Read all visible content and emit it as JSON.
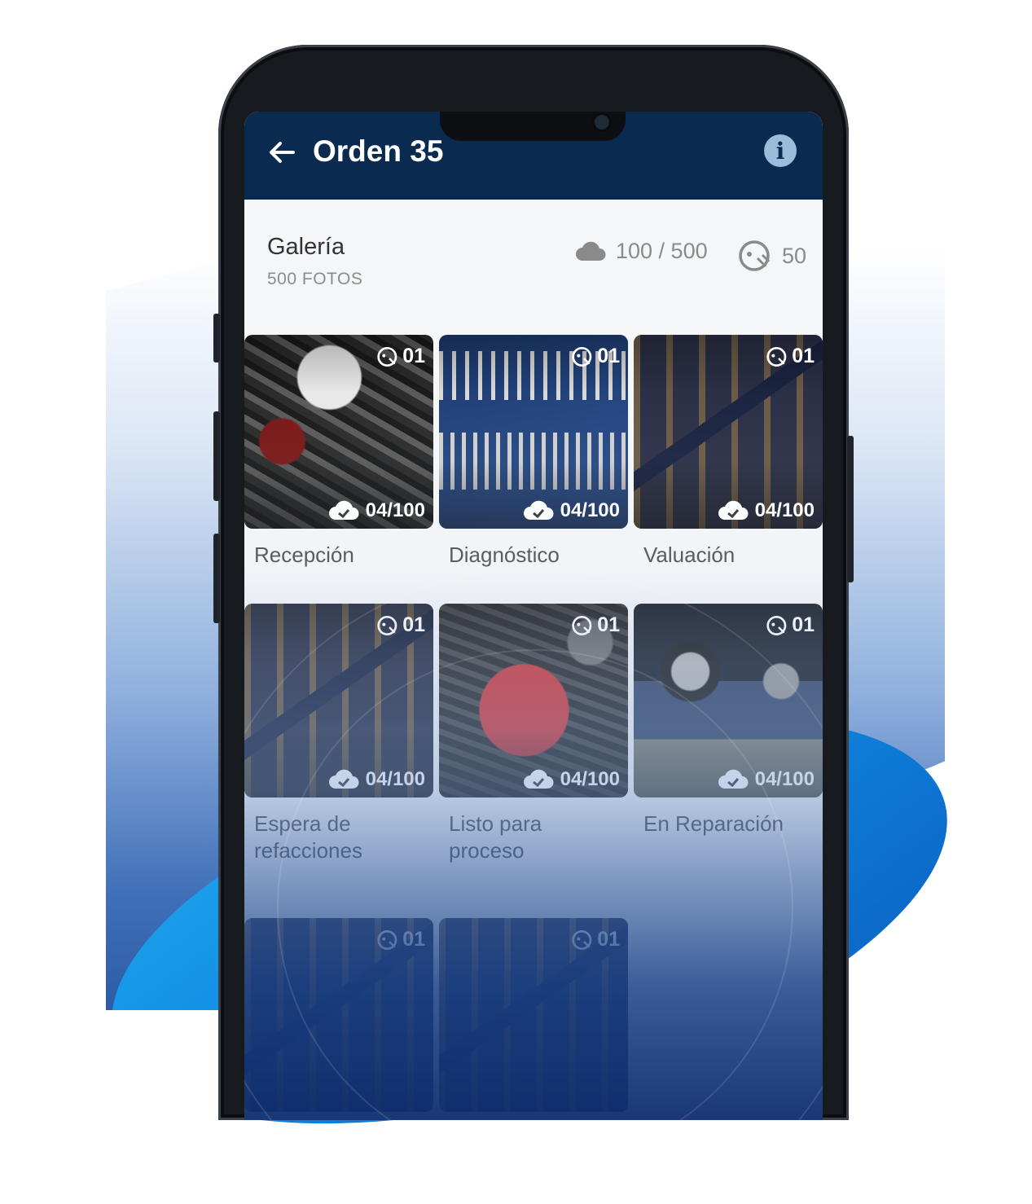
{
  "appbar": {
    "title": "Orden 35"
  },
  "gallery": {
    "title": "Galería",
    "subtitle": "500 FOTOS",
    "cloud_stat": "100 / 500",
    "ai_stat": "50"
  },
  "items": [
    {
      "label": "Recepción",
      "count": "01",
      "uploaded": "04/100"
    },
    {
      "label": "Diagnóstico",
      "count": "01",
      "uploaded": "04/100"
    },
    {
      "label": "Valuación",
      "count": "01",
      "uploaded": "04/100"
    },
    {
      "label": "Espera de refacciones",
      "count": "01",
      "uploaded": "04/100"
    },
    {
      "label": "Listo para proceso",
      "count": "01",
      "uploaded": "04/100"
    },
    {
      "label": "En Reparación",
      "count": "01",
      "uploaded": "04/100"
    },
    {
      "label": "",
      "count": "01",
      "uploaded": ""
    },
    {
      "label": "",
      "count": "01",
      "uploaded": ""
    }
  ],
  "colors": {
    "appbar": "#0a2a4f",
    "accent": "#0f86df"
  },
  "icons": {
    "back": "arrow-left-icon",
    "info": "info-icon",
    "cloud": "cloud-icon",
    "ai": "ai-face-icon",
    "cloud_check": "cloud-check-icon"
  }
}
